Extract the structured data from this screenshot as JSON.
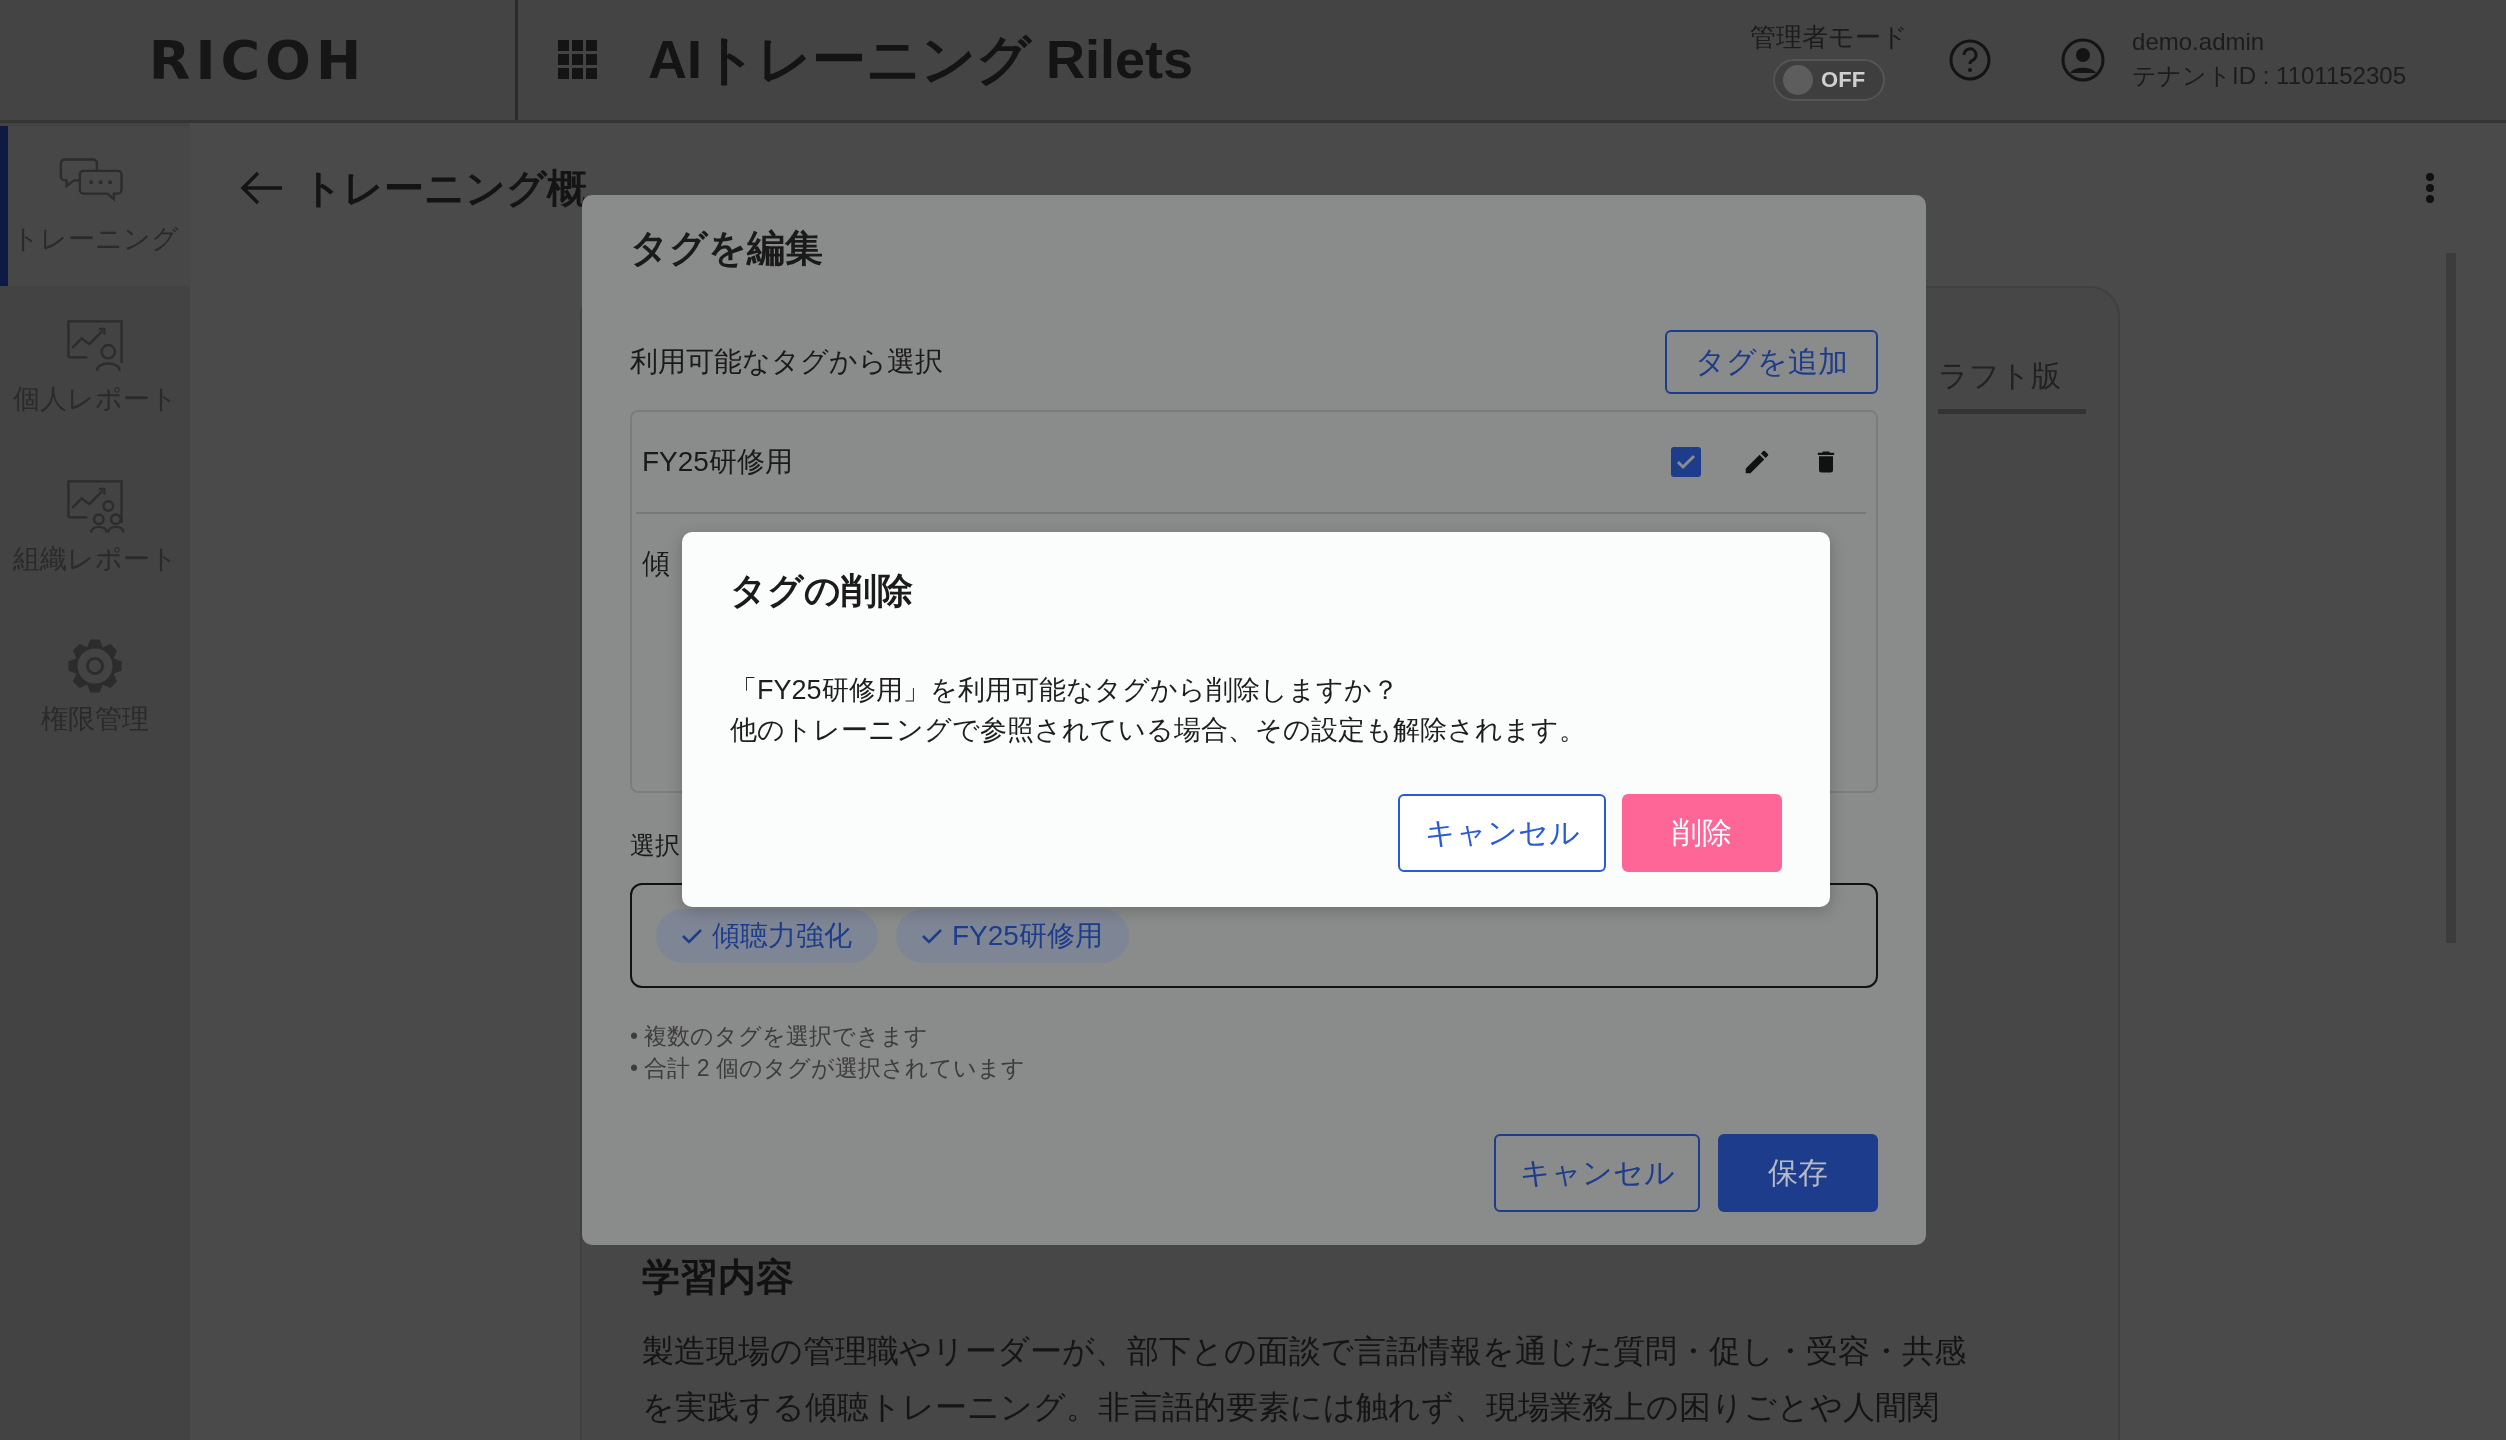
{
  "header": {
    "logo": "RICOH",
    "app_title": "AIトレーニング Rilets",
    "admin_mode": {
      "label": "管理者モード",
      "on": false,
      "state_text": "OFF"
    },
    "user": {
      "name": "demo.admin",
      "tenant": "テナントID : 1101152305"
    }
  },
  "sidebar": {
    "items": [
      {
        "label": "トレーニング",
        "selected": true
      },
      {
        "label": "個人レポート",
        "selected": false
      },
      {
        "label": "組織レポート",
        "selected": false
      },
      {
        "label": "権限管理",
        "selected": false
      }
    ]
  },
  "page": {
    "title": "トレーニング概"
  },
  "card": {
    "tabs": [
      {
        "label": "ラフト版",
        "selected": true
      }
    ],
    "section_title": "学習内容",
    "description_lines": [
      "製造現場の管理職やリーダーが、部下との面談で言語情報を通じた質問・促し・受容・共感",
      "を実践する傾聴トレーニング。非言語的要素には触れず、現場業務上の困りごとや人間関"
    ]
  },
  "edit_dialog": {
    "title": "タグを編集",
    "available_label": "利用可能なタグから選択",
    "add_button": "タグを追加",
    "tags": [
      {
        "label": "FY25研修用",
        "checked": true
      },
      {
        "label": "傾"
      }
    ],
    "selected_label": "選択",
    "selected_tags": [
      "傾聴力強化",
      "FY25研修用"
    ],
    "notes": [
      "• 複数のタグを選択できます",
      "• 合計 2 個のタグが選択されています"
    ],
    "buttons": [
      {
        "label": "キャンセル",
        "kind": "secondary"
      },
      {
        "label": "保存",
        "kind": "primary"
      }
    ]
  },
  "delete_dialog": {
    "title": "タグの削除",
    "message_lines": [
      "「FY25研修用」を利用可能なタグから削除しますか？",
      "他のトレーニングで参照されている場合、その設定も解除されます。"
    ],
    "buttons": [
      {
        "label": "キャンセル",
        "kind": "secondary"
      },
      {
        "label": "削除",
        "kind": "danger"
      }
    ]
  }
}
